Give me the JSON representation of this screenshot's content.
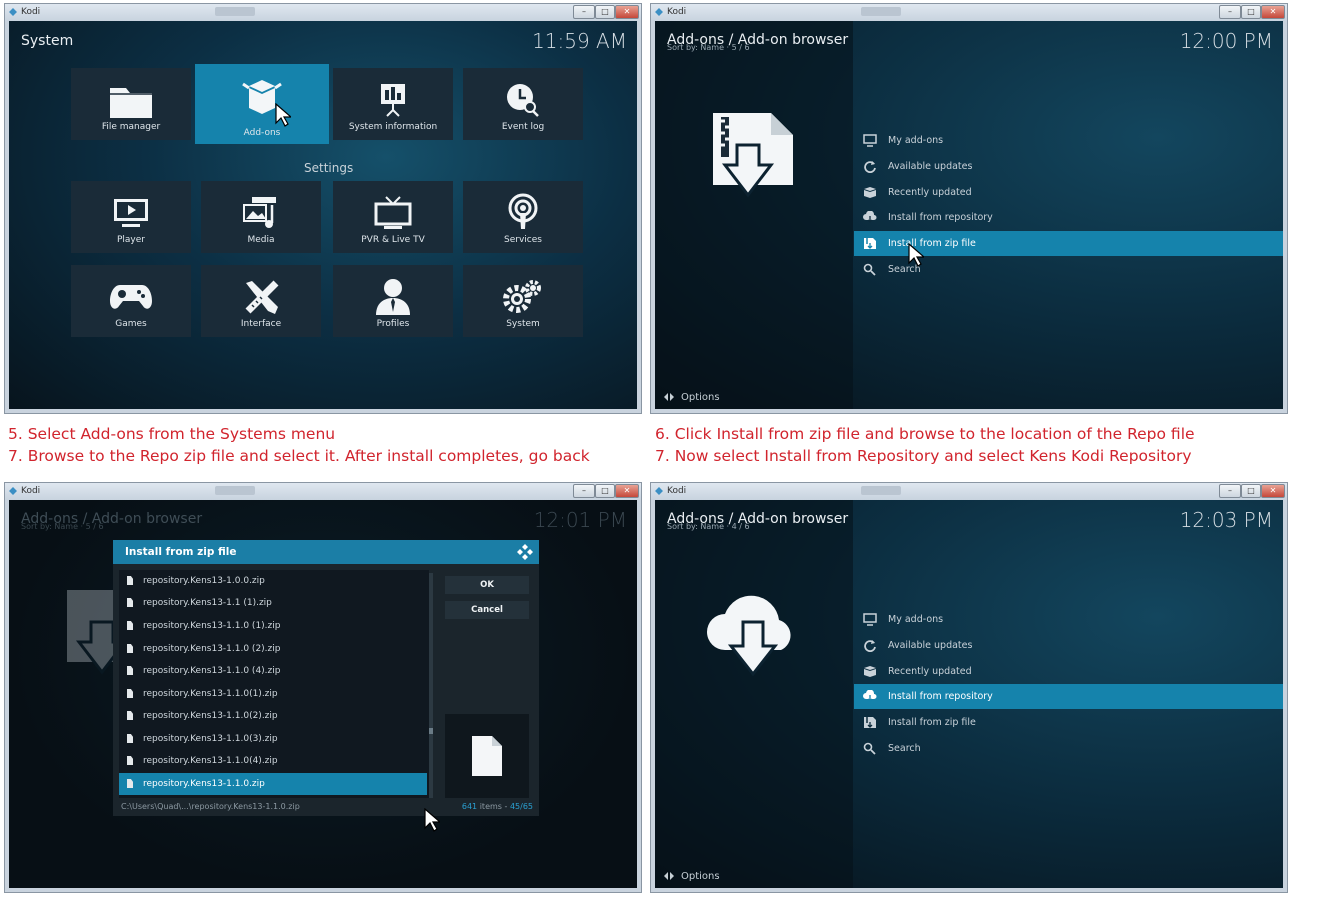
{
  "windows": {
    "top_left": {
      "title": "Kodi",
      "header_title": "System",
      "clock": "11:59 AM",
      "top_tiles": [
        {
          "label": "File manager",
          "icon": "folder-icon"
        },
        {
          "label": "Add-ons",
          "icon": "addons-box-icon",
          "selected": true
        },
        {
          "label": "System information",
          "icon": "presentation-icon"
        },
        {
          "label": "Event log",
          "icon": "clock-search-icon"
        }
      ],
      "settings_label": "Settings",
      "settings_tiles": [
        {
          "label": "Player",
          "icon": "tv-play-icon"
        },
        {
          "label": "Media",
          "icon": "media-icon"
        },
        {
          "label": "PVR & Live TV",
          "icon": "tv-antenna-icon"
        },
        {
          "label": "Services",
          "icon": "podcast-icon"
        },
        {
          "label": "Games",
          "icon": "gamepad-icon"
        },
        {
          "label": "Interface",
          "icon": "pencil-ruler-icon"
        },
        {
          "label": "Profiles",
          "icon": "user-icon"
        },
        {
          "label": "System",
          "icon": "gears-icon"
        }
      ]
    },
    "top_right": {
      "title": "Kodi",
      "header_title": "Add-ons / Add-on browser",
      "header_sub": "Sort by: Name  ·  5 / 6",
      "clock": "12:00 PM",
      "menu": [
        {
          "label": "My add-ons",
          "icon": "monitor-icon"
        },
        {
          "label": "Available updates",
          "icon": "refresh-icon"
        },
        {
          "label": "Recently updated",
          "icon": "box-icon"
        },
        {
          "label": "Install from repository",
          "icon": "cloud-download-icon"
        },
        {
          "label": "Install from zip file",
          "icon": "zip-icon",
          "selected": true
        },
        {
          "label": "Search",
          "icon": "search-icon"
        }
      ],
      "options": "Options"
    },
    "bottom_left": {
      "title": "Kodi",
      "header_title": "Add-ons / Add-on browser",
      "header_sub": "Sort by: Name  ·  5 / 6",
      "clock": "12:01 PM",
      "dialog": {
        "title": "Install from zip file",
        "files": [
          "repository.Kens13-1.0.0.zip",
          "repository.Kens13-1.1 (1).zip",
          "repository.Kens13-1.1.0 (1).zip",
          "repository.Kens13-1.1.0 (2).zip",
          "repository.Kens13-1.1.0 (4).zip",
          "repository.Kens13-1.1.0(1).zip",
          "repository.Kens13-1.1.0(2).zip",
          "repository.Kens13-1.1.0(3).zip",
          "repository.Kens13-1.1.0(4).zip",
          "repository.Kens13-1.1.0.zip"
        ],
        "selected_index": 9,
        "ok": "OK",
        "cancel": "Cancel",
        "path": "C:\\Users\\Quad\\...\\repository.Kens13-1.1.0.zip",
        "count_items": "641",
        "count_word": "items",
        "count_pos": "45/65"
      }
    },
    "bottom_right": {
      "title": "Kodi",
      "header_title": "Add-ons / Add-on browser",
      "header_sub": "Sort by: Name  ·  4 / 6",
      "clock": "12:03 PM",
      "menu": [
        {
          "label": "My add-ons",
          "icon": "monitor-icon"
        },
        {
          "label": "Available updates",
          "icon": "refresh-icon"
        },
        {
          "label": "Recently updated",
          "icon": "box-icon"
        },
        {
          "label": "Install from repository",
          "icon": "cloud-download-icon",
          "selected": true
        },
        {
          "label": "Install from zip file",
          "icon": "zip-icon"
        },
        {
          "label": "Search",
          "icon": "search-icon"
        }
      ],
      "options": "Options"
    }
  },
  "captions": {
    "left_1": "5. Select Add-ons from the Systems menu",
    "left_2": "7. Browse to the Repo zip file and select it.  After install completes, go back",
    "right_1": "6. Click Install from zip file and browse to the location of the Repo file",
    "right_2": "7. Now select Install from Repository and select Kens Kodi Repository"
  },
  "colors": {
    "accent": "#1583ac",
    "caption": "#d1242d",
    "tile_bg": "#1a2b38"
  }
}
